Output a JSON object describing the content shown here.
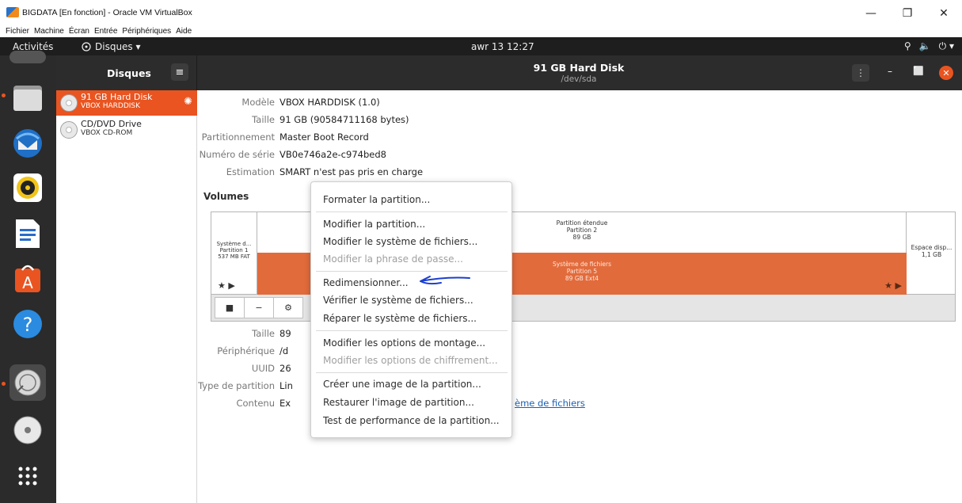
{
  "vbox": {
    "title": "BIGDATA [En fonction] - Oracle VM VirtualBox",
    "menu": [
      "Fichier",
      "Machine",
      "Écran",
      "Entrée",
      "Périphériques",
      "Aide"
    ],
    "min": "—",
    "max": "❐",
    "close": "✕"
  },
  "topbar": {
    "activities": "Activités",
    "app_name": "Disques ▾",
    "clock": "awr 13  12:27",
    "tray": [
      "⚲",
      "🔈",
      "⏻ ▾"
    ]
  },
  "header": {
    "title": "Disques",
    "menu_icon": "≡",
    "disk_title": "91 GB Hard Disk",
    "disk_sub": "/dev/sda",
    "kebab": "⋮",
    "min": "–",
    "max": "⬜",
    "close": "✕"
  },
  "drives": [
    {
      "name": "91 GB Hard Disk",
      "sub": "VBOX HARDDISK",
      "selected": true
    },
    {
      "name": "CD/DVD Drive",
      "sub": "VBOX CD-ROM",
      "selected": false
    }
  ],
  "disk_info": [
    {
      "key": "Modèle",
      "value": "VBOX HARDDISK (1.0)"
    },
    {
      "key": "Taille",
      "value": "91 GB (90584711168 bytes)"
    },
    {
      "key": "Partitionnement",
      "value": "Master Boot Record"
    },
    {
      "key": "Numéro de série",
      "value": "VB0e746a2e-c974bed8"
    },
    {
      "key": "Estimation",
      "value": "SMART n'est pas pris en charge"
    }
  ],
  "volumes": {
    "title": "Volumes",
    "p1": {
      "line1": "Système d...",
      "line2": "Partition 1",
      "line3": "537 MB FAT"
    },
    "ext": {
      "line1": "Partition étendue",
      "line2": "Partition 2",
      "line3": "89 GB"
    },
    "p5": {
      "line1": "Système de fichiers",
      "line2": "Partition 5",
      "line3": "89 GB Ext4"
    },
    "free": {
      "line1": "Espace disp...",
      "line2": "1,1 GB"
    },
    "stop": "■",
    "minus": "−",
    "gear": "⚙"
  },
  "part_info": [
    {
      "key": "Taille",
      "value": "89"
    },
    {
      "key": "Périphérique",
      "value": "/d"
    },
    {
      "key": "UUID",
      "value": "26"
    },
    {
      "key": "Type de partition",
      "value": "Lin"
    },
    {
      "key": "Contenu",
      "value": "Ex"
    }
  ],
  "content_link": "ème de fichiers",
  "context_menu": {
    "items": [
      {
        "label": "Formater la partition...",
        "disabled": false
      },
      {
        "label": "Modifier la partition...",
        "disabled": false
      },
      {
        "label": "Modifier le système de fichiers...",
        "disabled": false
      },
      {
        "label": "Modifier la phrase de passe...",
        "disabled": true
      },
      {
        "label": "Redimensionner...",
        "disabled": false
      },
      {
        "label": "Vérifier le système de fichiers...",
        "disabled": false
      },
      {
        "label": "Réparer le système de fichiers...",
        "disabled": false
      },
      {
        "label": "Modifier les options de montage...",
        "disabled": false
      },
      {
        "label": "Modifier les options de chiffrement...",
        "disabled": true
      },
      {
        "label": "Créer une image de la partition...",
        "disabled": false
      },
      {
        "label": "Restaurer l'image de partition...",
        "disabled": false
      },
      {
        "label": "Test de performance de la partition...",
        "disabled": false
      }
    ]
  },
  "colors": {
    "accent": "#e95420",
    "partition": "#e26b3c",
    "annotation": "#1c3fd0"
  }
}
